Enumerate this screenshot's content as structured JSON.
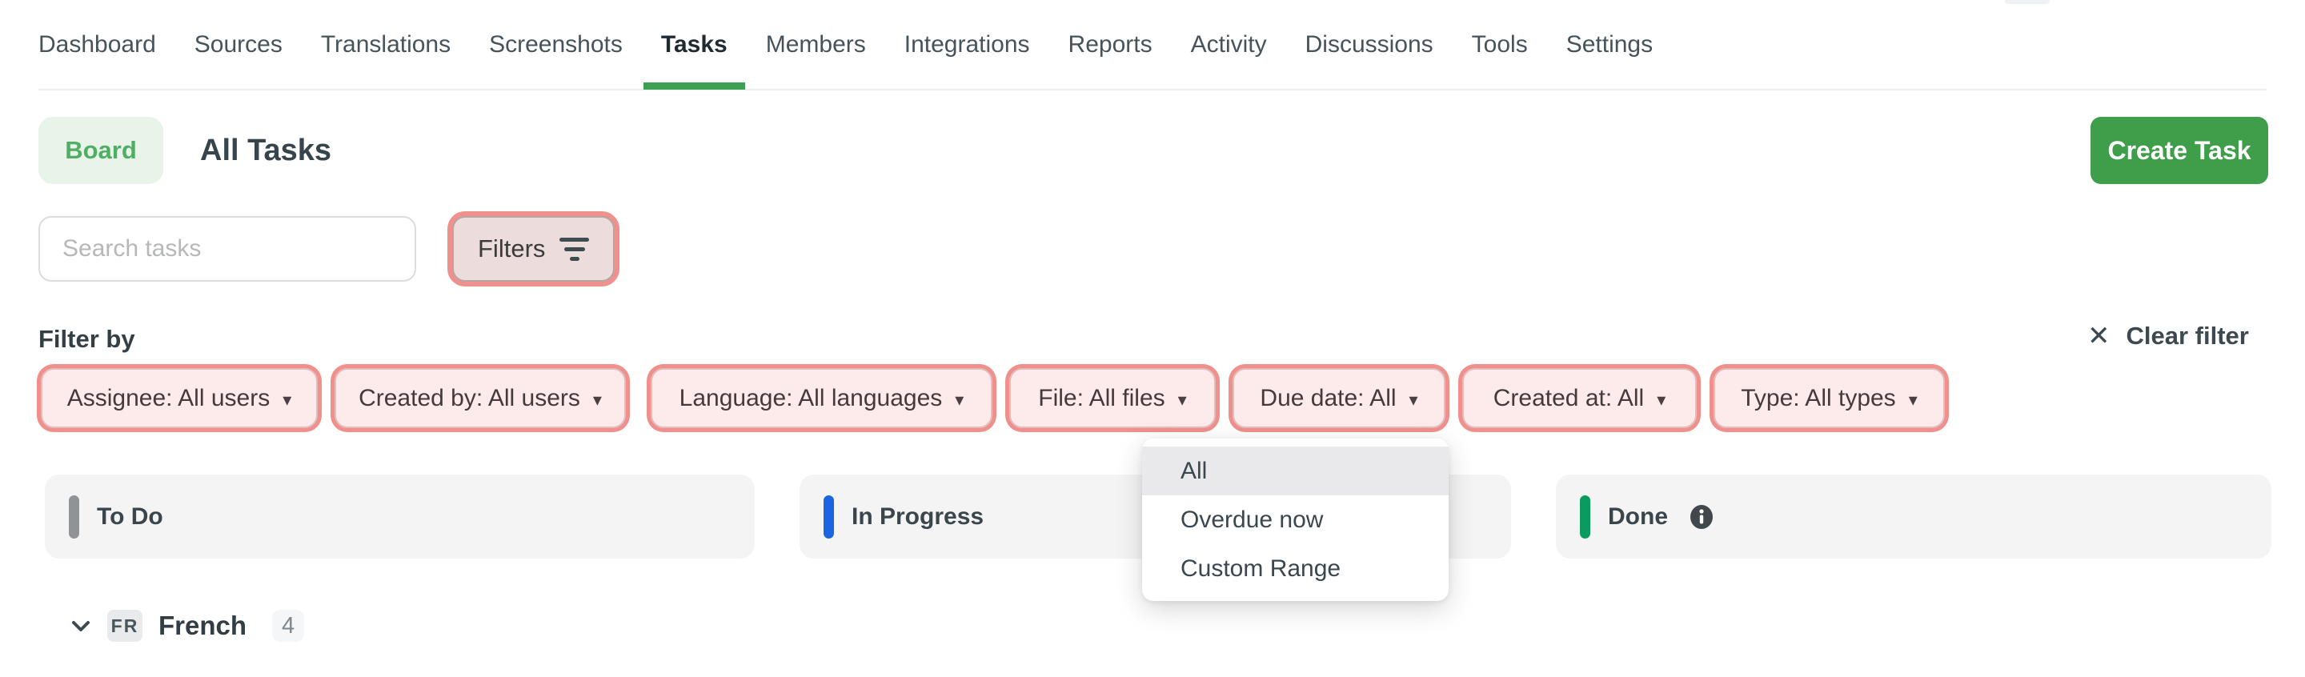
{
  "theme": {
    "accent_green": "#3e9e4a",
    "active_tab_underline": "#3da052",
    "board_badge_bg": "#e8f4ea",
    "board_badge_text": "#4fae62",
    "filter_highlight_ring": "#f0908d",
    "filter_chip_bg": "#fdeaea",
    "todo_pill": "#909396",
    "in_progress_pill": "#1a66e0",
    "done_pill": "#0c9b5e",
    "menu_selected_bg": "#e9e9eb",
    "column_bg": "#f4f4f5"
  },
  "icons": {
    "caret": "▾",
    "close": "✕"
  },
  "nav": {
    "items": [
      {
        "label": "Dashboard"
      },
      {
        "label": "Sources"
      },
      {
        "label": "Translations"
      },
      {
        "label": "Screenshots"
      },
      {
        "label": "Tasks",
        "active": true
      },
      {
        "label": "Members"
      },
      {
        "label": "Integrations"
      },
      {
        "label": "Reports"
      },
      {
        "label": "Activity"
      },
      {
        "label": "Discussions"
      },
      {
        "label": "Tools"
      },
      {
        "label": "Settings"
      }
    ]
  },
  "header": {
    "board_label": "Board",
    "title": "All Tasks",
    "create_task_label": "Create Task"
  },
  "toolbar": {
    "search_placeholder": "Search tasks",
    "filters_label": "Filters"
  },
  "filters": {
    "section_label": "Filter by",
    "clear_label": "Clear filter",
    "chips": [
      "Assignee: All users",
      "Created by: All users",
      "Language: All languages",
      "File: All files",
      "Due date: All",
      "Created at: All",
      "Type: All types"
    ]
  },
  "due_date_menu": {
    "selected": "All",
    "items": [
      "All",
      "Overdue now",
      "Custom Range"
    ]
  },
  "board": {
    "columns": [
      {
        "name": "To Do",
        "color": "#909396"
      },
      {
        "name": "In Progress",
        "color": "#1a66e0"
      },
      {
        "name": "Done",
        "color": "#0c9b5e",
        "has_info": true
      }
    ]
  },
  "language_group": {
    "code": "FR",
    "name": "French",
    "count": "4"
  }
}
